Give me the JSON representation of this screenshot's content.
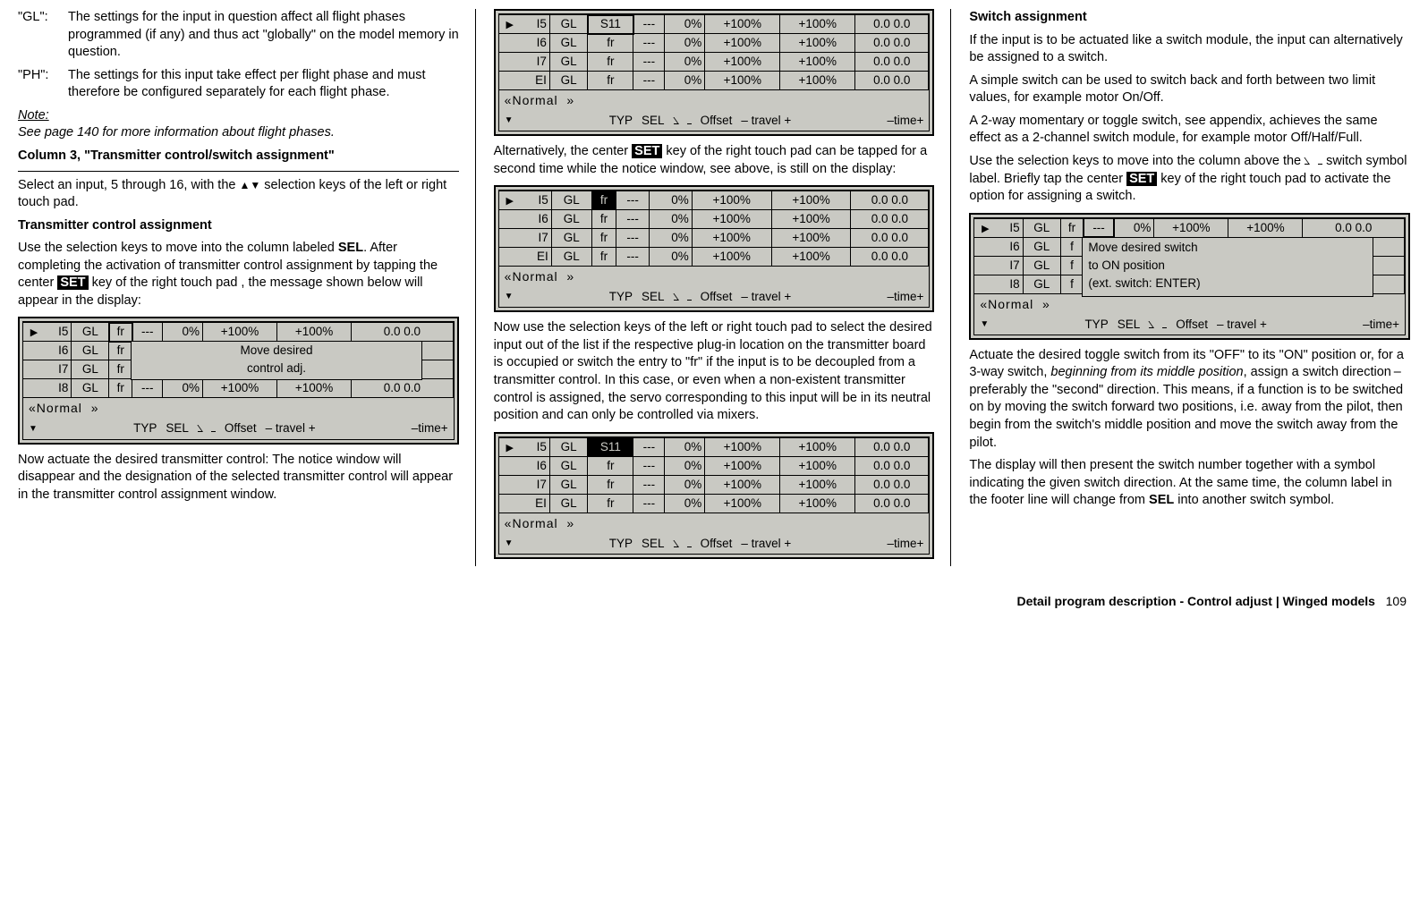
{
  "col1": {
    "def1_term": "\"GL\":",
    "def1_text": "The settings for the input in question affect all flight phases programmed (if any) and thus act \"globally\" on the model memory in question.",
    "def2_term": "\"PH\":",
    "def2_text": "The settings for this input take effect per flight phase and must therefore be configured separately for each flight phase.",
    "note_label": "Note:",
    "note_text": "See page 140 for more information about flight phases.",
    "heading1": "Column 3, \"Transmitter control/switch assignment\"",
    "para1a": "Select an input, 5 through 16, with the ",
    "para1b": " selection keys of the left or right touch pad.",
    "heading2": "Transmitter control assignment",
    "para2a": "Use the selection keys to move into the column labeled ",
    "para2b": ". After completing the activation of transmitter control assignment by tapping the center ",
    "para2c": " key of the right touch pad , the message shown below will appear in the display:",
    "sel": "SEL",
    "set": "SET",
    "para3": "Now actuate the desired transmitter control: The notice window will disappear and the designation of the selected transmitter control will appear in the transmitter control assignment window."
  },
  "col2": {
    "para1a": "Alternatively, the center ",
    "para1b": " key of the right touch pad can be tapped for a second time while the notice window, see above, is still on the display:",
    "para2": "Now use the selection keys of the left or right touch pad to select the desired input out of the list if the respective plug-in location on the transmitter board is occupied or switch the entry to \"fr\" if the input is to be decoupled from a transmitter control. In this case, or even when a non-existent transmitter control is assigned, the servo corresponding to this input will be in its neutral position and can only be controlled via mixers."
  },
  "col3": {
    "heading1": "Switch assignment",
    "para1": "If the input is to be actuated like a switch module, the input can alternatively be assigned to a switch.",
    "para2": "A simple switch can be used to switch back and forth between two limit values, for example motor On/Off.",
    "para3": "A 2-way momentary or toggle switch, see appendix, achieves the same effect as a 2-channel switch module, for example motor Off/Half/Full.",
    "para4a": "Use the selection keys to move into the column above the ",
    "para4b": " switch symbol label. Briefly tap the center ",
    "para4c": " key of the right touch pad to activate the option for assigning a switch.",
    "para5a": "Actuate the desired toggle switch from its \"OFF\" to its \"ON\" position or, for a 3-way switch, ",
    "para5b": "beginning from its middle position",
    "para5c": ", assign a switch direction – preferably the \"second\" direction. This means, if a function is to be switched on by moving the switch forward two positions, i.e. away from the pilot, then begin from the switch's middle position and move the switch away from the pilot.",
    "para6a": "The display will then present the switch number together with a symbol indicating the given switch direction. At the same time, the column label in the footer line will change from ",
    "para6b": " into another switch symbol."
  },
  "lcd_common": {
    "normal": "Normal",
    "footer_typ": "TYP",
    "footer_sel": "SEL",
    "footer_offset": "Offset",
    "footer_travel": "– travel +",
    "footer_time": "–time+",
    "gl": "GL",
    "fr": "fr",
    "dash": "---",
    "pct0": "0%",
    "pct100": "+100%",
    "zeros": "0.0 0.0"
  },
  "lcd1": {
    "r1": "I5",
    "r2": "I6",
    "r3": "I7",
    "r4": "I8",
    "overlay1": "Move desired",
    "overlay2": "control adj."
  },
  "lcd2": {
    "r1": "I5",
    "r2": "I6",
    "r3": "I7",
    "r4": "EI",
    "s11": "S11"
  },
  "lcd3": {
    "r1": "I5",
    "r2": "I6",
    "r3": "I7",
    "r4": "EI"
  },
  "lcd4": {
    "r1": "I5",
    "r2": "I6",
    "r3": "I7",
    "r4": "EI",
    "s11": "S11"
  },
  "lcd5": {
    "r1": "I5",
    "r2": "I6",
    "r3": "I7",
    "r4": "I8",
    "ov1": "Move desired switch",
    "ov2": "to ON position",
    "ov3": "(ext. switch: ENTER)",
    "ppct": "0%"
  },
  "footer": {
    "text": "Detail program description - Control adjust | Winged models",
    "page": "109"
  }
}
